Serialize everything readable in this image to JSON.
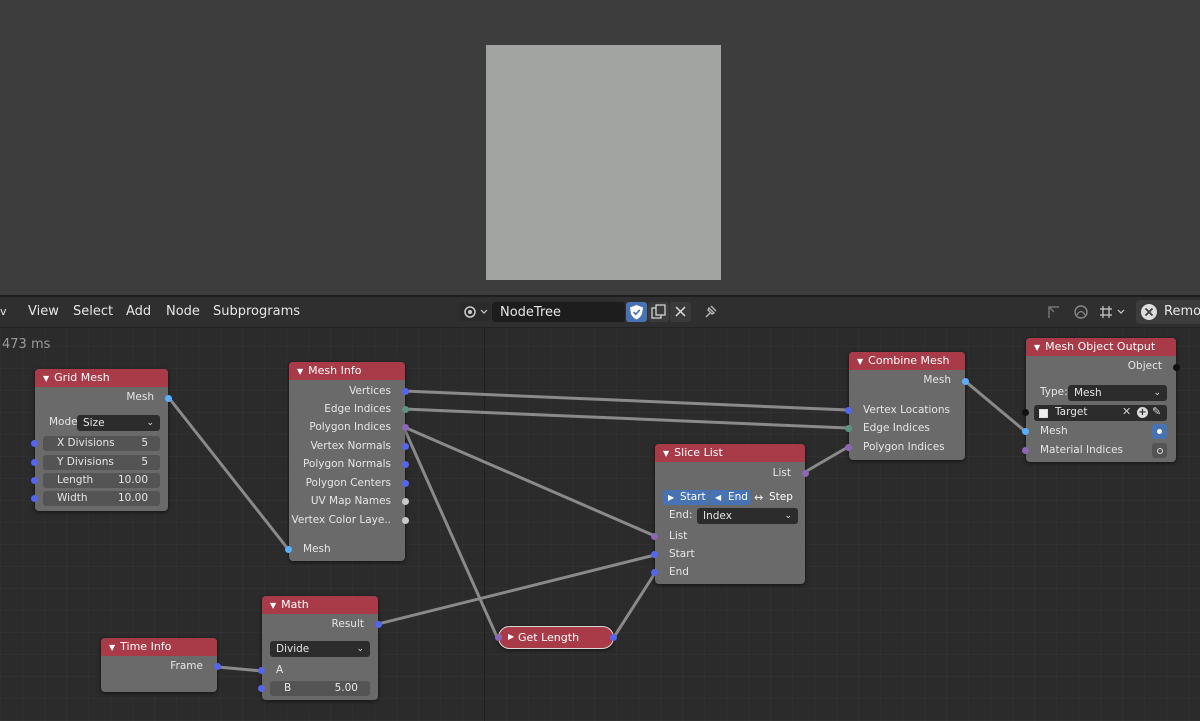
{
  "header": {
    "menu_chevron": "v",
    "menus": [
      "View",
      "Select",
      "Add",
      "Node",
      "Subprograms"
    ],
    "node_tree_name": "NodeTree",
    "remove_label": "Remov"
  },
  "editor": {
    "timing": "473 ms"
  },
  "nodes": {
    "grid_mesh": {
      "title": "Grid Mesh",
      "out_mesh": "Mesh",
      "mode_label": "Mode",
      "mode_value": "Size",
      "fields": [
        {
          "label": "X Divisions",
          "value": "5"
        },
        {
          "label": "Y Divisions",
          "value": "5"
        },
        {
          "label": "Length",
          "value": "10.00"
        },
        {
          "label": "Width",
          "value": "10.00"
        }
      ]
    },
    "mesh_info": {
      "title": "Mesh Info",
      "outputs": [
        "Vertices",
        "Edge Indices",
        "Polygon Indices",
        "Vertex Normals",
        "Polygon Normals",
        "Polygon Centers",
        "UV Map Names",
        "Vertex Color Laye.."
      ],
      "input": "Mesh"
    },
    "combine_mesh": {
      "title": "Combine Mesh",
      "out_mesh": "Mesh",
      "inputs": [
        "Vertex Locations",
        "Edge Indices",
        "Polygon Indices"
      ]
    },
    "mesh_object_output": {
      "title": "Mesh Object Output",
      "out_object": "Object",
      "type_label": "Type:",
      "type_value": "Mesh",
      "target": "Target",
      "inputs": [
        "Mesh",
        "Material Indices"
      ]
    },
    "slice_list": {
      "title": "Slice List",
      "out_list": "List",
      "start_btn": "Start",
      "end_btn": "End",
      "step_btn": "Step",
      "end_label": "End:",
      "end_value": "Index",
      "inputs": [
        "List",
        "Start",
        "End"
      ]
    },
    "math": {
      "title": "Math",
      "out_result": "Result",
      "operation": "Divide",
      "input_a": "A",
      "b_label": "B",
      "b_value": "5.00"
    },
    "time_info": {
      "title": "Time Info",
      "out_frame": "Frame"
    },
    "get_length": {
      "title": "Get Length"
    }
  },
  "colors": {
    "node_header": "#a93a48",
    "node_body": "#6a6a6a",
    "selected_blue": "#4772b3"
  }
}
